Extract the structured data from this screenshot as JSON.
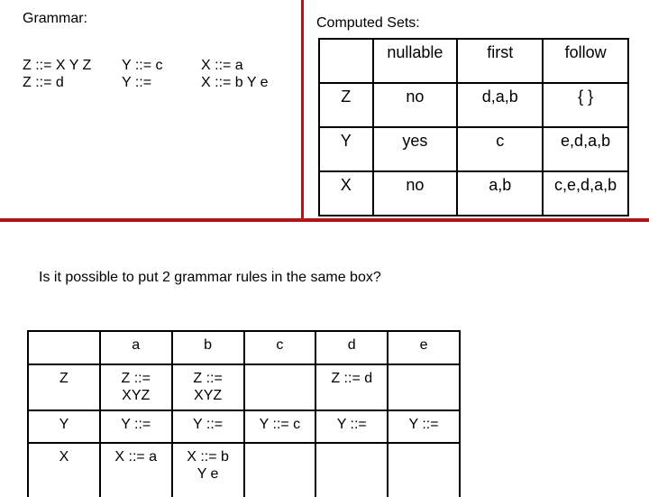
{
  "grammar": {
    "title": "Grammar:",
    "columns": [
      [
        "Z ::= X Y Z",
        "Z ::= d"
      ],
      [
        "Y ::= c",
        "Y ::="
      ],
      [
        "X ::= a",
        "X ::= b Y e"
      ]
    ]
  },
  "computed_sets": {
    "title": "Computed Sets:",
    "headers": [
      "",
      "nullable",
      "first",
      "follow"
    ],
    "rows": [
      [
        "Z",
        "no",
        "d,a,b",
        "{ }"
      ],
      [
        "Y",
        "yes",
        "c",
        "e,d,a,b"
      ],
      [
        "X",
        "no",
        "a,b",
        "c,e,d,a,b"
      ]
    ]
  },
  "question": "Is it possible to put 2 grammar rules in the same box?",
  "parse_table": {
    "headers": [
      "",
      "a",
      "b",
      "c",
      "d",
      "e"
    ],
    "rows": [
      [
        [
          "Z"
        ],
        [
          "Z ::=",
          "XYZ"
        ],
        [
          "Z ::=",
          "XYZ"
        ],
        [
          ""
        ],
        [
          "Z ::= d"
        ],
        [
          ""
        ]
      ],
      [
        [
          "Y"
        ],
        [
          "Y ::="
        ],
        [
          "Y ::="
        ],
        [
          "Y ::= c"
        ],
        [
          "Y ::="
        ],
        [
          "Y ::="
        ]
      ],
      [
        [
          "X"
        ],
        [
          "X ::= a"
        ],
        [
          "X ::= b",
          "Y e"
        ],
        [
          ""
        ],
        [
          ""
        ],
        [
          ""
        ]
      ]
    ]
  },
  "colors": {
    "divider": "#b3141b"
  }
}
